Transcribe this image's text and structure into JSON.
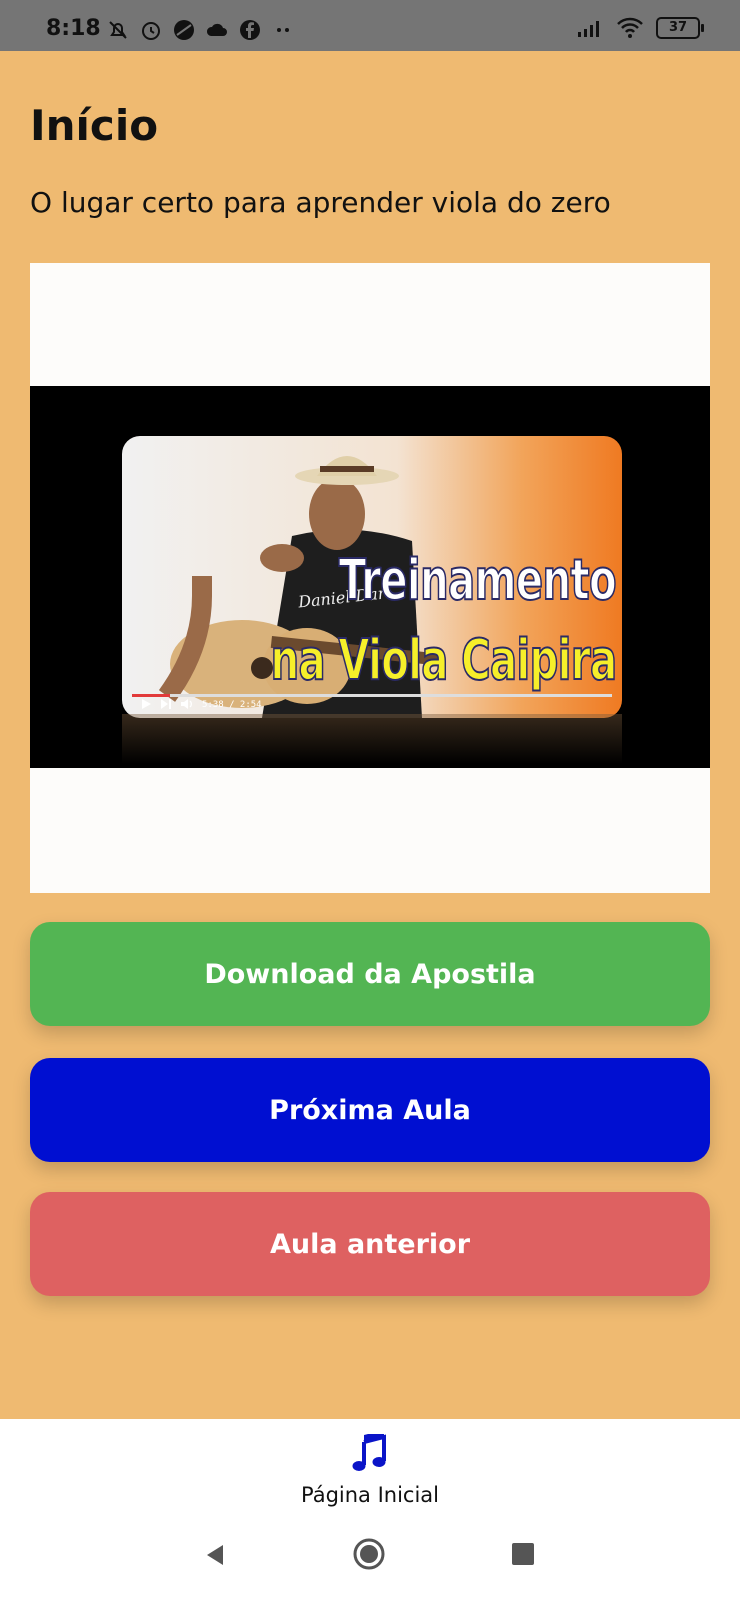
{
  "status_bar": {
    "time": "8:18",
    "battery": "37",
    "left_icons": [
      "mute-bell-icon",
      "alarm-icon",
      "circle-app-icon",
      "cloud-icon",
      "facebook-icon",
      "more-dots-icon"
    ],
    "right_icons": [
      "signal-icon",
      "wifi-icon",
      "battery-icon"
    ]
  },
  "page": {
    "title": "Início",
    "subtitle": "O lugar certo para aprender viola do zero"
  },
  "video": {
    "thumbnail_title_line1": "Treinamento",
    "thumbnail_title_line2": "na Viola Caipira",
    "shirt_text": "Daniel Dar",
    "player_time": "5:38 / 2:54",
    "progress": 0.08
  },
  "buttons": {
    "download": "Download da Apostila",
    "next": "Próxima Aula",
    "previous": "Aula anterior"
  },
  "colors": {
    "background": "#efba71",
    "download": "#53b553",
    "next": "#000fd1",
    "previous": "#de6161"
  },
  "bottom_nav": {
    "label": "Página Inicial",
    "icon": "music-note-icon"
  },
  "system_nav": {
    "icons": [
      "back-icon",
      "home-icon",
      "recent-apps-icon"
    ]
  }
}
